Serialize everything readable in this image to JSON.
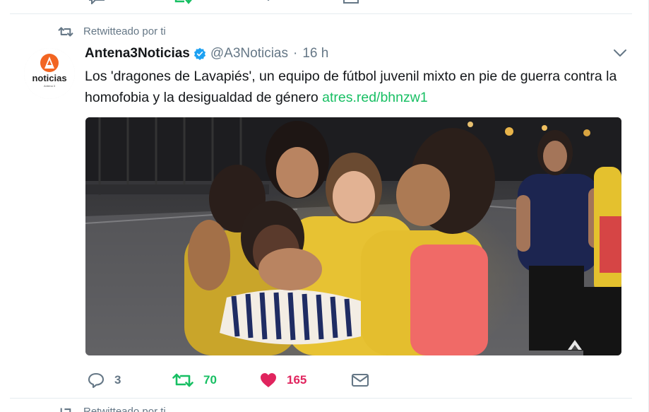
{
  "previous_tweet": {
    "reply_count": "",
    "retweet_count": "",
    "like_count": ""
  },
  "tweet": {
    "retweet_context": "Retwitteado por ti",
    "author_name": "Antena3Noticias",
    "author_handle": "@A3Noticias",
    "separator": "·",
    "timestamp": "16 h",
    "text": "Los 'dragones de Lavapiés', un equipo de fútbol juvenil mixto en pie de guerra contra la homofobia y la desigualdad de género",
    "link": "atres.red/bhnzw1",
    "avatar_logo_text": "noticias",
    "avatar_logo_subtext": "Antena 3",
    "reply_count": "3",
    "retweet_count": "70",
    "like_count": "165",
    "icons": {
      "retweet_context": "retweet-icon",
      "verified": "verified-badge-icon",
      "caret": "chevron-down-icon",
      "reply": "reply-icon",
      "retweet": "retweet-icon",
      "like": "heart-icon",
      "dm": "envelope-icon"
    }
  },
  "next_tweet": {
    "retweet_context": "Retwitteado por ti"
  },
  "colors": {
    "accent_green": "#17bf63",
    "like_red": "#e0245e",
    "muted_gray": "#657786",
    "verified_blue": "#1da1f2",
    "brand_orange": "#f26522"
  }
}
